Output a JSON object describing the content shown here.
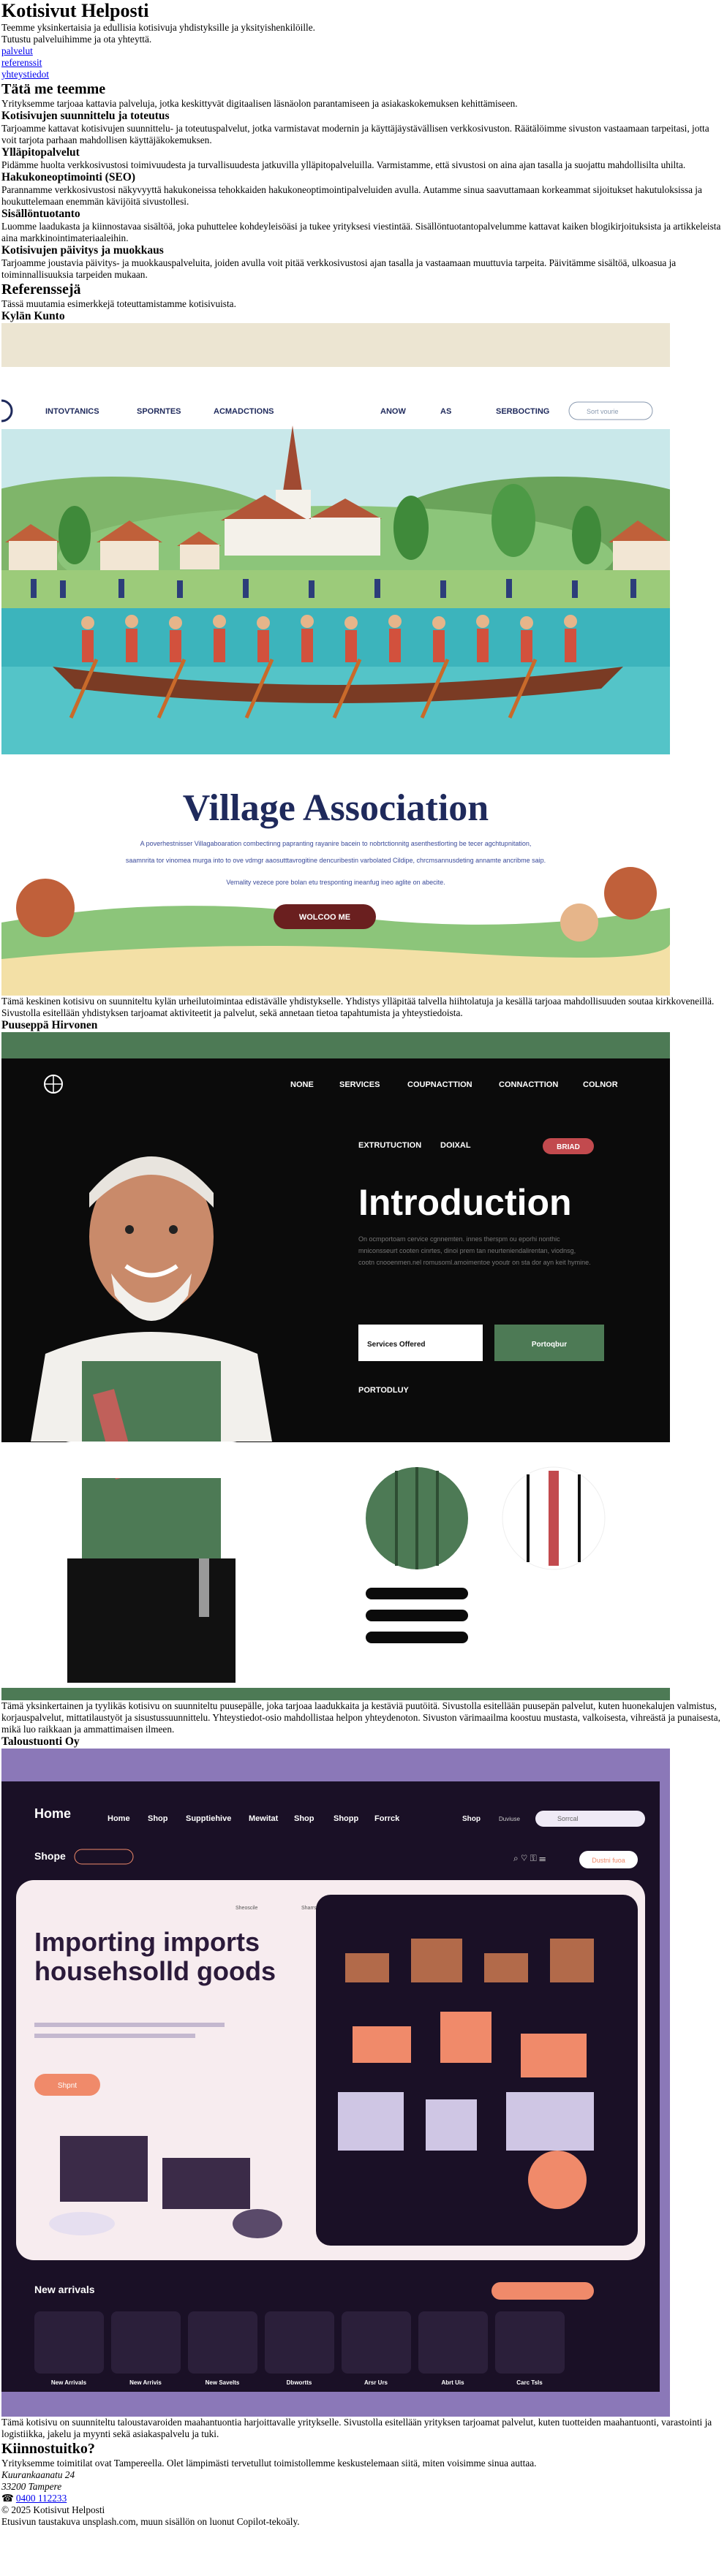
{
  "header": {
    "title": "Kotisivut Helposti",
    "tagline": "Teemme yksinkertaisia ja edullisia kotisivuja yhdistyksille ja yksityishenkilöille.",
    "intro": "Tutustu palveluihimme ja ota yhteyttä.",
    "nav": [
      "palvelut",
      "referenssit",
      "yhteystiedot"
    ]
  },
  "services": {
    "heading": "Tätä me teemme",
    "intro": "Yrityksemme tarjoaa kattavia palveluja, jotka keskittyvät digitaalisen läsnäolon parantamiseen ja asiakaskokemuksen kehittämiseen.",
    "items": [
      {
        "title": "Kotisivujen suunnittelu ja toteutus",
        "text": "Tarjoamme kattavat kotisivujen suunnittelu- ja toteutuspalvelut, jotka varmistavat modernin ja käyttäjäystävällisen verkkosivuston. Räätälöimme sivuston vastaamaan tarpeitasi, jotta voit tarjota parhaan mahdollisen käyttäjäkokemuksen."
      },
      {
        "title": "Ylläpitopalvelut",
        "text": "Pidämme huolta verkkosivustosi toimivuudesta ja turvallisuudesta jatkuvilla ylläpitopalveluilla. Varmistamme, että sivustosi on aina ajan tasalla ja suojattu mahdollisilta uhilta."
      },
      {
        "title": "Hakukoneoptimointi (SEO)",
        "text": "Parannamme verkkosivustosi näkyvyyttä hakukoneissa tehokkaiden hakukoneoptimointipalveluiden avulla. Autamme sinua saavuttamaan korkeammat sijoitukset hakutuloksissa ja houkuttelemaan enemmän kävijöitä sivustollesi."
      },
      {
        "title": "Sisällöntuotanto",
        "text": "Luomme laadukasta ja kiinnostavaa sisältöä, joka puhuttelee kohdeyleisöäsi ja tukee yrityksesi viestintää. Sisällöntuotantopalvelumme kattavat kaiken blogikirjoituksista ja artikkeleista aina markkinointimateriaaleihin."
      },
      {
        "title": "Kotisivujen päivitys ja muokkaus",
        "text": "Tarjoamme joustavia päivitys- ja muokkauspalveluita, joiden avulla voit pitää verkkosivustosi ajan tasalla ja vastaamaan muuttuvia tarpeita. Päivitämme sisältöä, ulkoasua ja toiminnallisuuksia tarpeiden mukaan."
      }
    ]
  },
  "references": {
    "heading": "Referenssejä",
    "intro": "Tässä muutamia esimerkkejä toteuttamistamme kotisivuista.",
    "items": [
      {
        "title": "Kylän Kunto",
        "text": "Tämä keskinen kotisivu on suunniteltu kylän urheilutoimintaa edistävälle yhdistykselle. Yhdistys ylläpitää talvella hiihtolatuja ja kesällä tarjoaa mahdollisuuden soutaa kirkkoveneillä. Sivustolla esitellään yhdistyksen tarjoamat aktiviteetit ja palvelut, sekä annetaan tietoa tapahtumista ja yhteystiedoista.",
        "mock": {
          "nav": [
            "INTOVTANICS",
            "SPORNTES",
            "ACMADCTIONS",
            "ANOW",
            "AS",
            "SERBOCTING"
          ],
          "search_placeholder": "Sort vourie",
          "heading": "Village Association",
          "line1": "A poverhestnisser Villagaboaration combectinng papranting rayanire bacein to nobrtctionnitg asenthestlorting be tecer agchtupnitation,",
          "line2": "saamnrita tor vinomea murga into to ove vdmgr aaosutttavrogitine dencuribestin varbolated Cildipe, chrcmsannusdeting annamte ancribme saip.",
          "line3": "Vemality vezece pore bolan etu tresponting ineanfug ineo aglite on abecite.",
          "button": "WOLCOO ME"
        }
      },
      {
        "title": "Puuseppä Hirvonen",
        "text": "Tämä yksinkertainen ja tyylikäs kotisivu on suunniteltu puusepälle, joka tarjoaa laadukkaita ja kestäviä puutöitä. Sivustolla esitellään puusepän palvelut, kuten huonekalujen valmistus, korjauspalvelut, mittatilaustyöt ja sisustussuunnittelu. Yhteystiedot-osio mahdollistaa helpon yhteydenoton. Sivuston värimaailma koostuu mustasta, valkoisesta, vihreästä ja punaisesta, mikä luo raikkaan ja ammattimaisen ilmeen.",
        "mock": {
          "nav": [
            "NONE",
            "SERVICES",
            "COUPNACTTION",
            "CONNACTTION",
            "COLNOR"
          ],
          "sub_nav": [
            "EXTRUTUCTION",
            "DOIXAL"
          ],
          "pill": "BRIAD",
          "heading": "Introduction",
          "body": "On ocmportoam cervice cgnnemten. innes therspm ou eporhi nonthic mniconsseurt cooten cinrtes, dinoi prem tan neurteniendalirentan, viodnsg, cootn cnooenmen.nel romusoml.amoimentoe yooutr on sta dor ayn keit hymine.",
          "btn1": "Services Offered",
          "btn2": "Portoqbur",
          "portfolio": "PORTODLUY"
        }
      },
      {
        "title": "Taloustuonti Oy",
        "text": "Tämä kotisivu on suunniteltu taloustavaroiden maahantuontia harjoittavalle yritykselle. Sivustolla esitellään yrityksen tarjoamat palvelut, kuten tuotteiden maahantuonti, varastointi ja logistiikka, jakelu ja myynti sekä asiakaspalvelu ja tuki.",
        "mock": {
          "brand": "Home",
          "nav": [
            "Home",
            "Shop",
            "Supptiehive",
            "Mewitat",
            "Shop",
            "Shopp",
            "Forrck"
          ],
          "top_right": [
            "Shop",
            "Duviuse"
          ],
          "search": "Sorrcal",
          "section": "Shope",
          "cta_right": "Dustni fuoa",
          "heading": "Importing imports househsolld goods",
          "hero_btn": "Shpnt",
          "caption1": "Sheoscile",
          "caption2": "Sharrs",
          "new_arrivals": "New arrivals",
          "products": [
            "New Arrivals",
            "New Arrivis",
            "New Savelts",
            "Dbwortts",
            "Arsr Urs",
            "Abrt Uis",
            "Carc Tsls"
          ]
        }
      }
    ]
  },
  "contact": {
    "heading": "Kiinnostuitko?",
    "text": "Yrityksemme toimitilat ovat Tampereella. Olet lämpimästi tervetullut toimistollemme keskustelemaan siitä, miten voisimme sinua auttaa.",
    "street": "Kuurankaanatu 24",
    "city": "33200 Tampere",
    "phone_icon": "☎",
    "phone": "0400 112233"
  },
  "footer": {
    "copyright": "© 2025 Kotisivut Helposti",
    "credits": "Etusivun taustakuva unsplash.com, muun sisällön on luonut Copilot-tekoäly."
  },
  "colors": {
    "village_sky": "#c9e8ea",
    "village_water": "#3cb4bc",
    "village_navy": "#1f2a5c",
    "carpenter_black": "#0b0b0b",
    "carpenter_green": "#4d7a55",
    "carpenter_red": "#c24a4e",
    "import_purple": "#8b78b8",
    "import_dark": "#1a1026",
    "import_orange": "#f08a6a"
  }
}
